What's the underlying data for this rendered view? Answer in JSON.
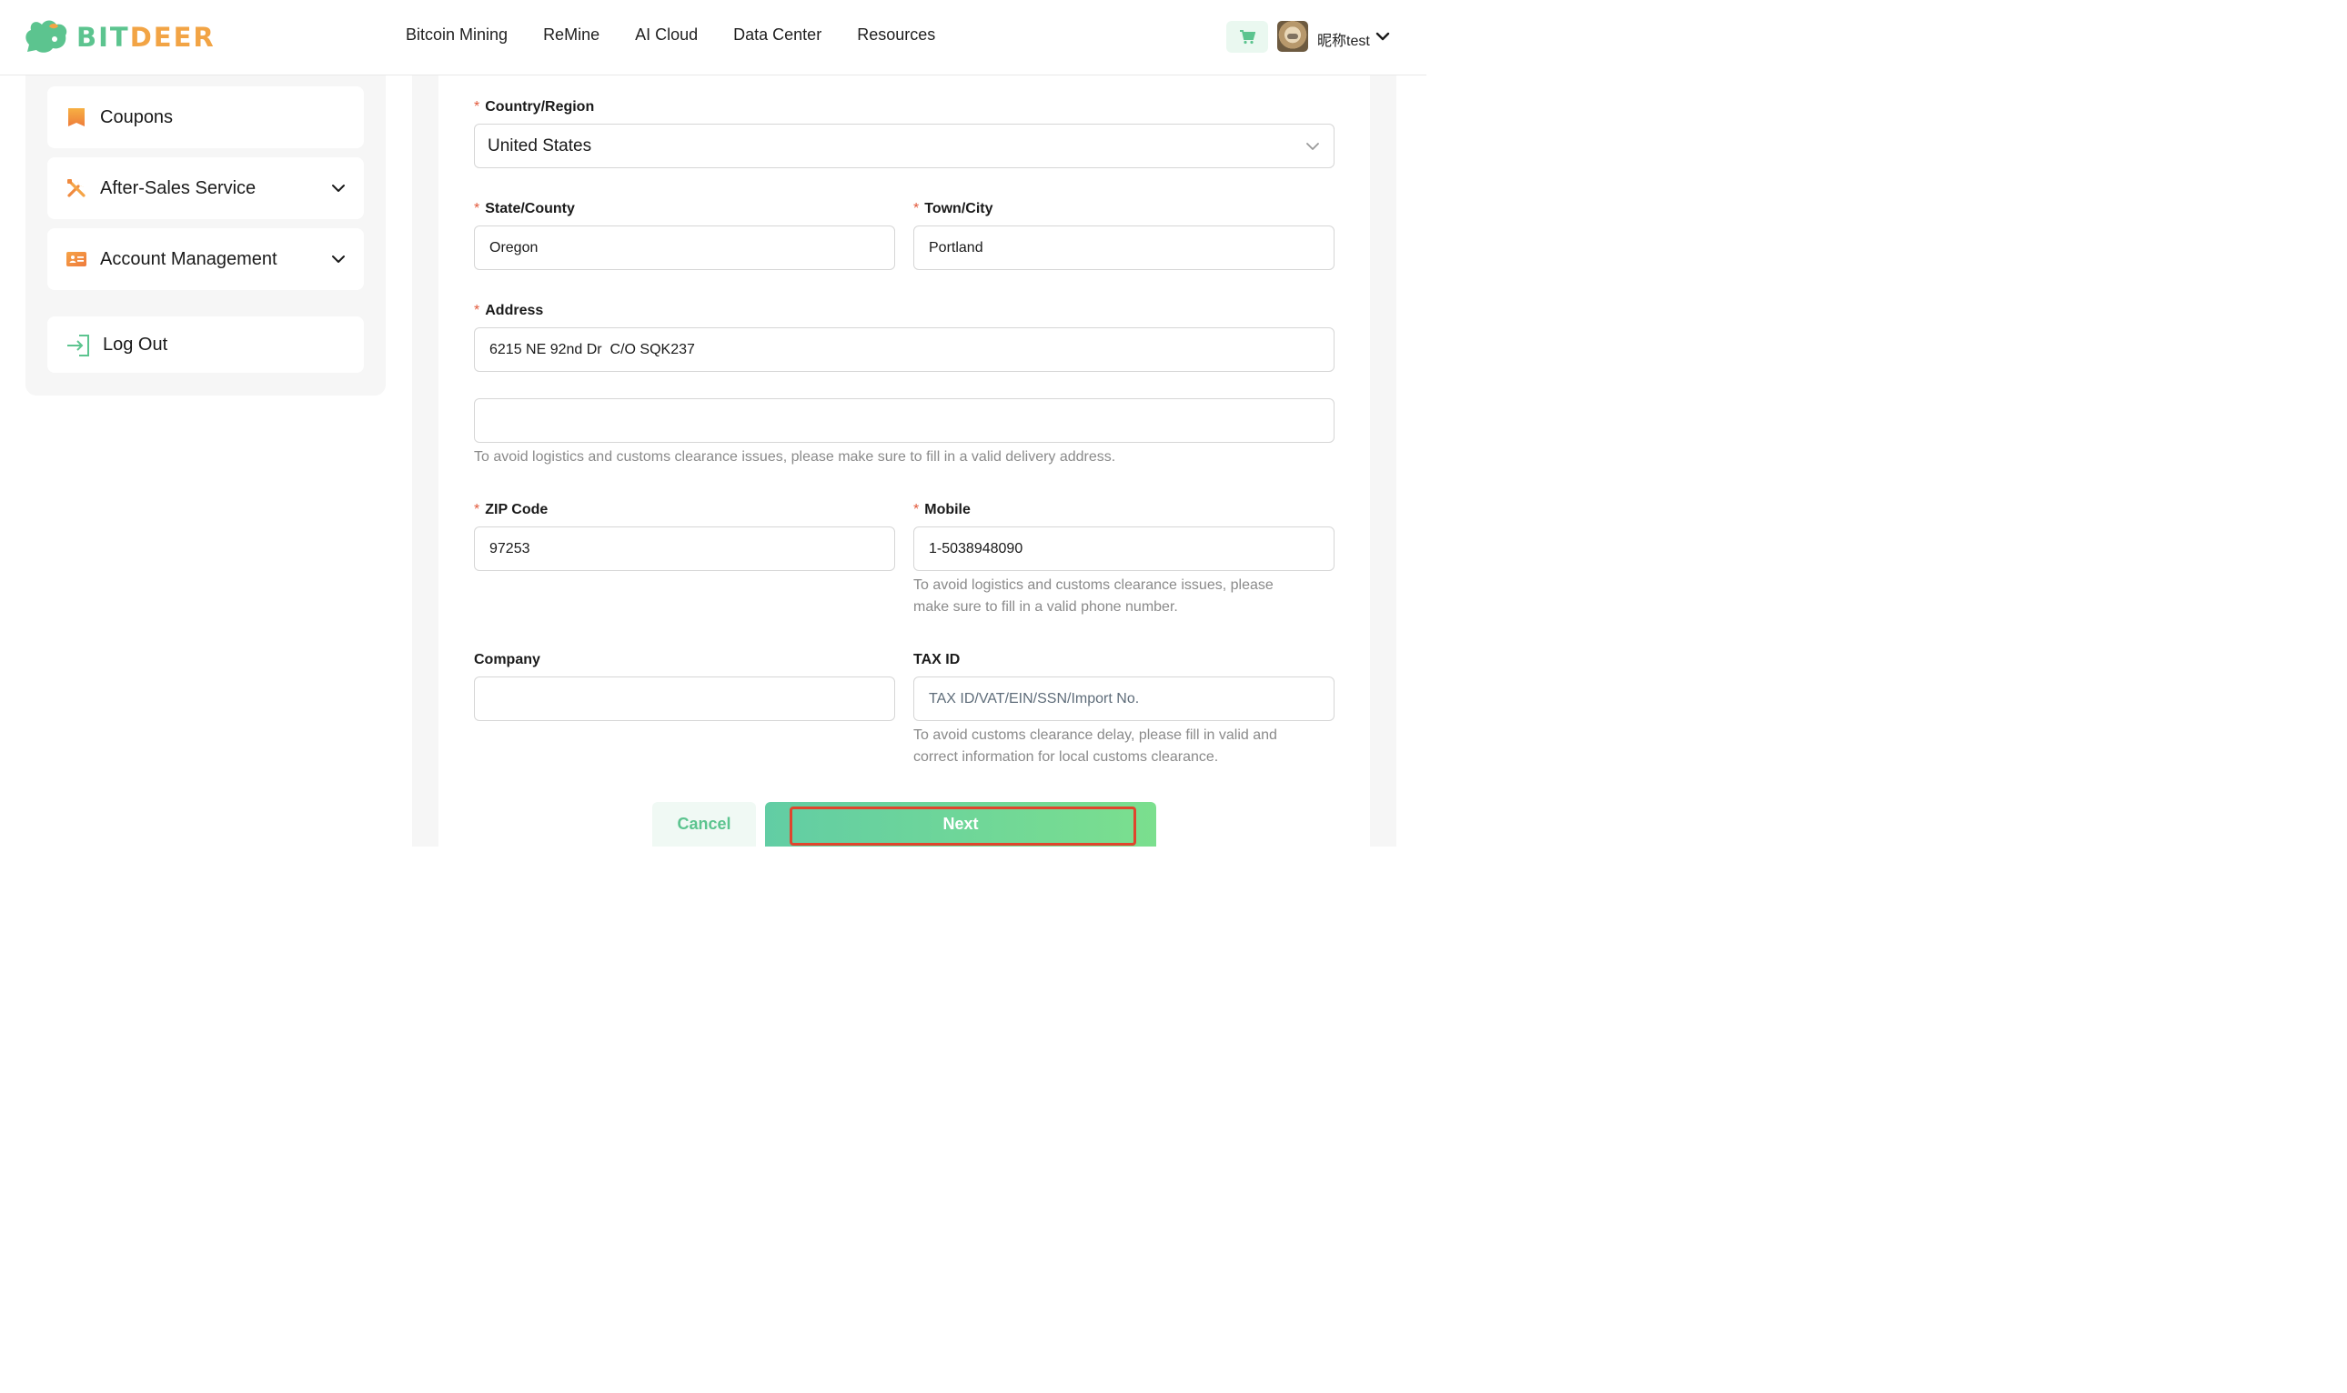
{
  "header": {
    "logo_left": "BIT",
    "logo_right": "DEER",
    "nav": [
      "Bitcoin Mining",
      "ReMine",
      "AI Cloud",
      "Data Center",
      "Resources"
    ],
    "username": "昵称test",
    "icons": {
      "cart": "cart-icon",
      "dropdown": "chevron-down-icon"
    }
  },
  "sidebar": {
    "items": [
      {
        "label": "Coupons",
        "icon": "coupon-icon"
      },
      {
        "label": "After-Sales Service",
        "icon": "tools-icon",
        "expandable": true
      },
      {
        "label": "Account Management",
        "icon": "id-card-icon",
        "expandable": true
      },
      {
        "label": "Log Out",
        "icon": "logout-icon"
      }
    ]
  },
  "form": {
    "country": {
      "label": "Country/Region",
      "value": "United States"
    },
    "state": {
      "label": "State/County",
      "value": "Oregon"
    },
    "city": {
      "label": "Town/City",
      "value": "Portland"
    },
    "address": {
      "label": "Address",
      "value": "6215 NE 92nd Dr  C/O SQK237",
      "line2_value": "",
      "hint": "To avoid logistics and customs clearance issues, please make sure to fill in a valid delivery address."
    },
    "zip": {
      "label": "ZIP Code",
      "value": "97253"
    },
    "mobile": {
      "label": "Mobile",
      "value": "1-5038948090",
      "hint_line1": "To avoid logistics and customs clearance issues, please",
      "hint_line2": "make sure to fill in a valid phone number."
    },
    "company": {
      "label": "Company",
      "value": ""
    },
    "tax": {
      "label": "TAX ID",
      "value": "",
      "placeholder": "TAX ID/VAT/EIN/SSN/Import No.",
      "hint_line1": "To avoid customs clearance delay, please fill in valid and",
      "hint_line2": "correct information for local customs clearance."
    },
    "required_mark": "*",
    "cancel_label": "Cancel",
    "next_label": "Next"
  },
  "colors": {
    "brand_green": "#5cc48f",
    "brand_orange": "#f2a445",
    "required": "#e25a3c",
    "highlight": "#e0452d"
  }
}
